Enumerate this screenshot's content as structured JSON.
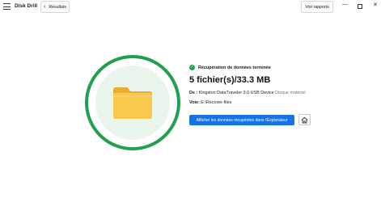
{
  "app": {
    "name": "Disk Drill"
  },
  "header": {
    "back_label": "Résultats",
    "report_label": "Voir rapports",
    "window_controls": {
      "minimize": "—",
      "close": "✕"
    }
  },
  "result": {
    "status": "Récupération de données terminée",
    "summary": "5 fichier(s)/33.3 MB",
    "device_label": "De :",
    "device_name": "Kingston DataTraveler 3.0 USB Device",
    "device_type": "Disque matériel",
    "path_label": "Voie:",
    "path_value": "E:\\Recover-files",
    "show_button": "Afficher les données récupérées dans l'Explorateur"
  },
  "icons": {
    "menu": "hamburger-icon",
    "back": "chevron-left-icon",
    "folder": "folder-icon",
    "success": "check-circle-icon",
    "home": "home-icon"
  },
  "colors": {
    "accent": "#1673e6",
    "success": "#22a04f",
    "ring_fill": "#e9f5ea",
    "folder": "#f9c94e"
  }
}
